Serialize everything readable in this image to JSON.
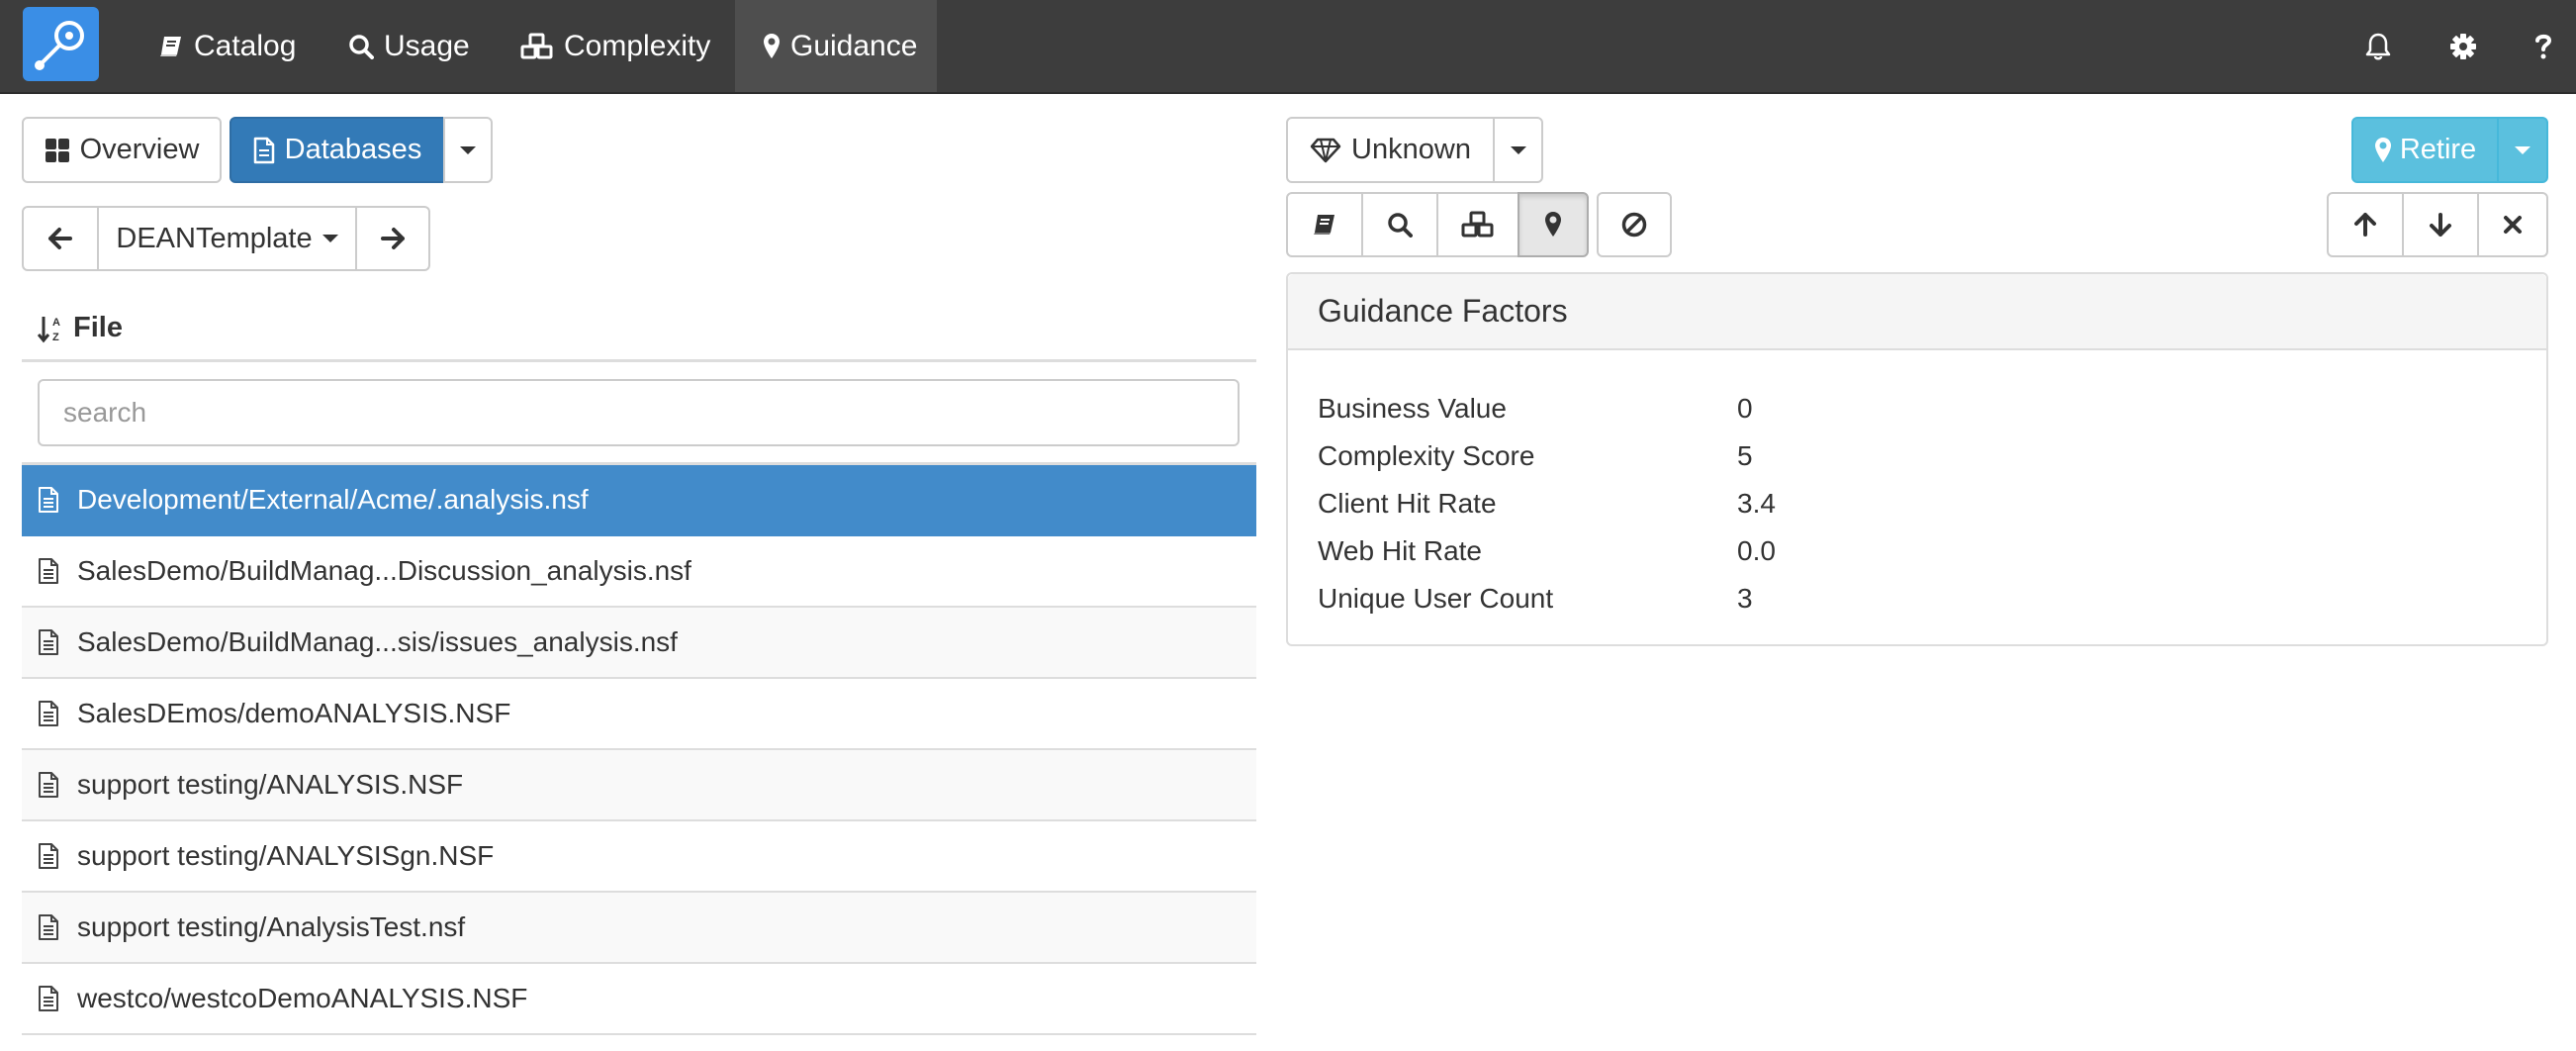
{
  "nav": {
    "items": [
      {
        "label": "Catalog"
      },
      {
        "label": "Usage"
      },
      {
        "label": "Complexity"
      },
      {
        "label": "Guidance"
      }
    ],
    "active": "Guidance"
  },
  "toolbar": {
    "overview_label": "Overview",
    "databases_label": "Databases",
    "template_label": "DEANTemplate",
    "value_label": "Unknown",
    "retire_label": "Retire"
  },
  "list": {
    "sort_label": "File",
    "search_placeholder": "search",
    "files": [
      "Development/External/Acme/.analysis.nsf",
      "SalesDemo/BuildManag...Discussion_analysis.nsf",
      "SalesDemo/BuildManag...sis/issues_analysis.nsf",
      "SalesDEmos/demoANALYSIS.NSF",
      "support testing/ANALYSIS.NSF",
      "support testing/ANALYSISgn.NSF",
      "support testing/AnalysisTest.nsf",
      "westco/westcoDemoANALYSIS.NSF"
    ],
    "selected_index": 0
  },
  "guidance": {
    "title": "Guidance Factors",
    "factors": [
      {
        "label": "Business Value",
        "value": "0"
      },
      {
        "label": "Complexity Score",
        "value": "5"
      },
      {
        "label": "Client Hit Rate",
        "value": "3.4"
      },
      {
        "label": "Web Hit Rate",
        "value": "0.0"
      },
      {
        "label": "Unique User Count",
        "value": "3"
      }
    ]
  },
  "icons": {
    "nav": [
      "logo-icon",
      "book-icon",
      "search-icon",
      "cubes-icon",
      "map-marker-icon"
    ],
    "right": [
      "bell-icon",
      "gear-icon",
      "question-icon"
    ],
    "view_tabs": [
      "book-icon",
      "search-icon",
      "cubes-icon",
      "map-marker-icon",
      "ban-icon"
    ],
    "actions": [
      "arrow-up-icon",
      "arrow-down-icon",
      "close-icon"
    ]
  },
  "colors": {
    "navbar": "#3d3d3d",
    "primary": "#337ab7",
    "selected_row": "#428bca",
    "info": "#5bc0de",
    "logo": "#3a8ee6"
  }
}
